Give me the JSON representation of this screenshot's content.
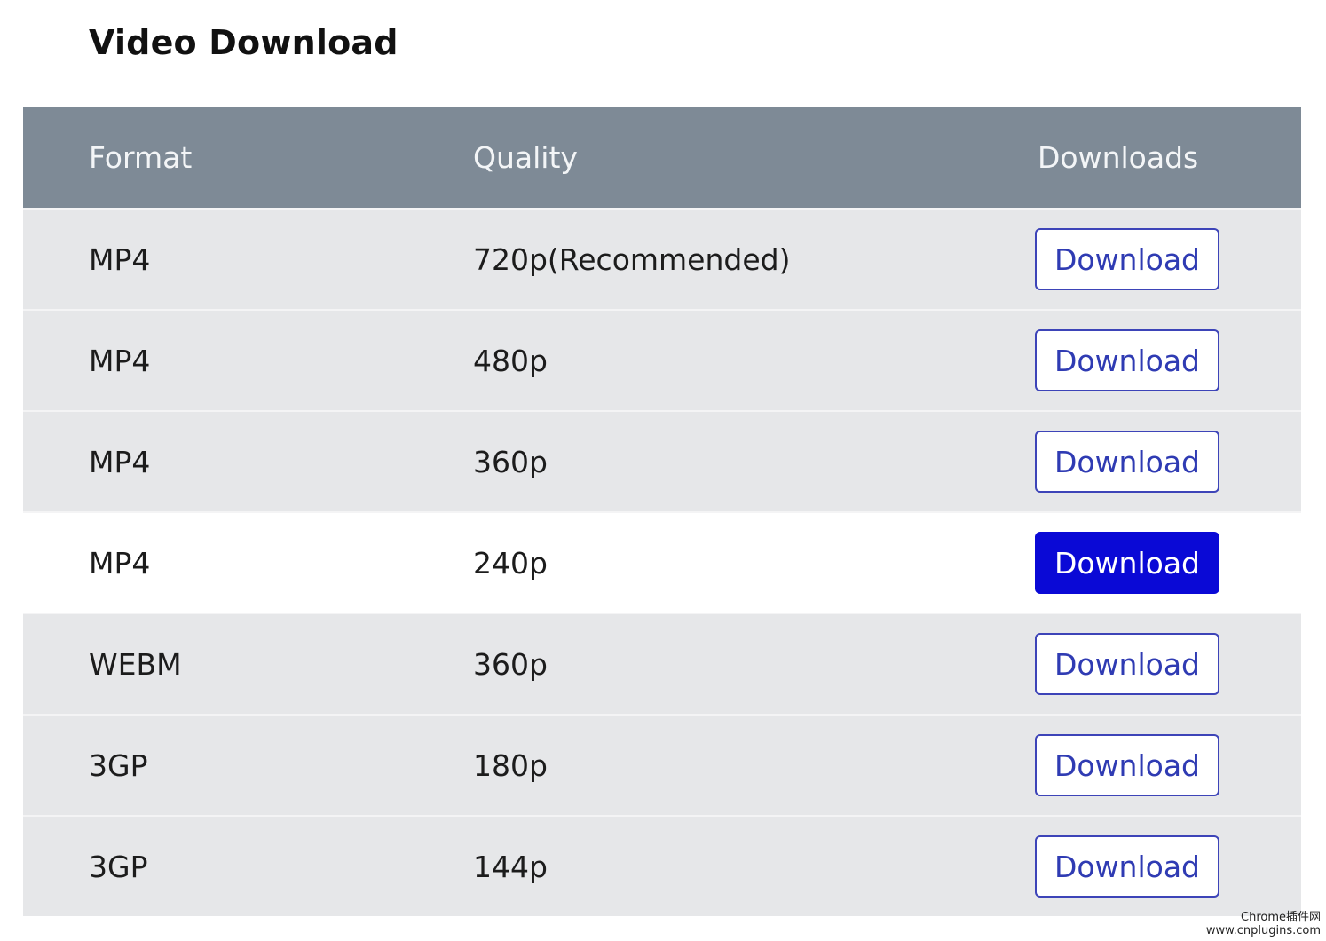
{
  "page": {
    "title": "Video Download"
  },
  "table": {
    "headers": {
      "format": "Format",
      "quality": "Quality",
      "downloads": "Downloads"
    },
    "rows": [
      {
        "format": "MP4",
        "quality": "720p(Recommended)",
        "action": "Download",
        "highlighted": false
      },
      {
        "format": "MP4",
        "quality": "480p",
        "action": "Download",
        "highlighted": false
      },
      {
        "format": "MP4",
        "quality": "360p",
        "action": "Download",
        "highlighted": false
      },
      {
        "format": "MP4",
        "quality": "240p",
        "action": "Download",
        "highlighted": true
      },
      {
        "format": "WEBM",
        "quality": "360p",
        "action": "Download",
        "highlighted": false
      },
      {
        "format": "3GP",
        "quality": "180p",
        "action": "Download",
        "highlighted": false
      },
      {
        "format": "3GP",
        "quality": "144p",
        "action": "Download",
        "highlighted": false
      }
    ]
  },
  "watermark": {
    "line1": "Chrome插件网",
    "line2": "www.cnplugins.com"
  },
  "colors": {
    "header_bg": "#7e8a96",
    "row_bg": "#e6e7e9",
    "highlight_row_bg": "#ffffff",
    "button_accent": "#0a09d6",
    "button_outline": "#3d44b8"
  }
}
